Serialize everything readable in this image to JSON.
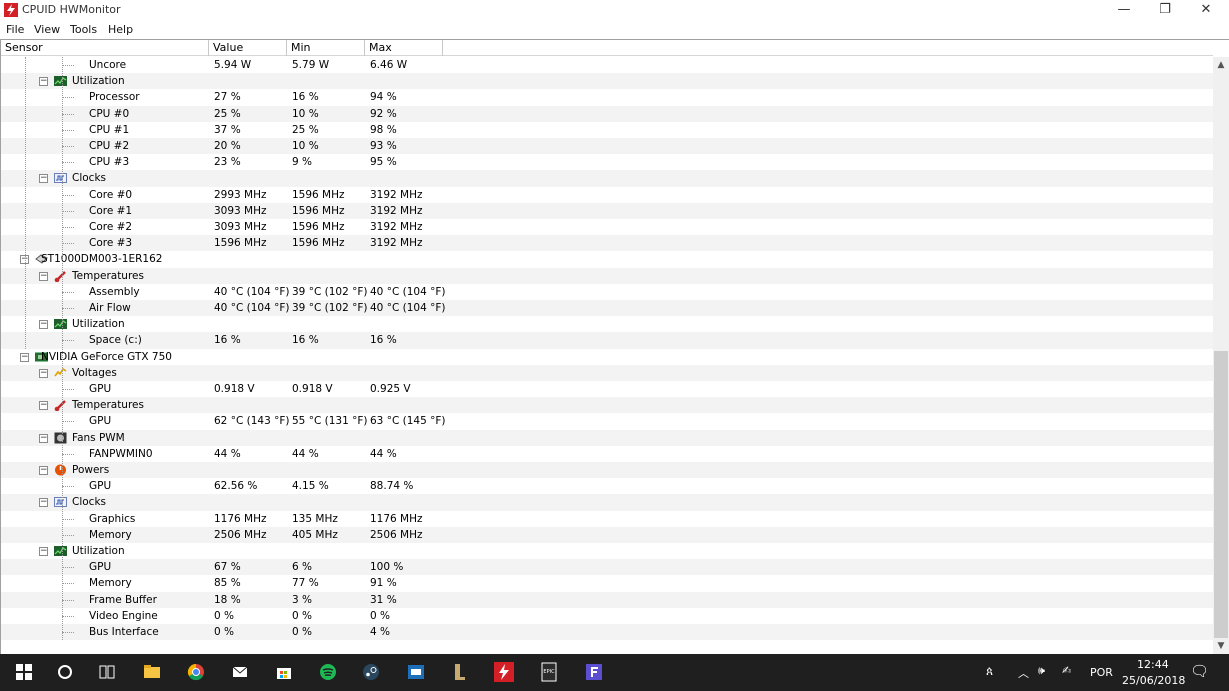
{
  "window": {
    "title": "CPUID HWMonitor",
    "min_glyph": "—",
    "max_glyph": "❐",
    "close_glyph": "✕"
  },
  "menu": [
    "File",
    "View",
    "Tools",
    "Help"
  ],
  "columns": {
    "sensor": "Sensor",
    "value": "Value",
    "min": "Min",
    "max": "Max"
  },
  "rows": [
    {
      "level": 2,
      "label": "Uncore",
      "value": "5.94 W",
      "min": "5.79 W",
      "max": "6.46 W"
    },
    {
      "level": 1,
      "label": "Utilization",
      "icon": "utilization-icon"
    },
    {
      "level": 2,
      "label": "Processor",
      "value": "27 %",
      "min": "16 %",
      "max": "94 %"
    },
    {
      "level": 2,
      "label": "CPU #0",
      "value": "25 %",
      "min": "10 %",
      "max": "92 %"
    },
    {
      "level": 2,
      "label": "CPU #1",
      "value": "37 %",
      "min": "25 %",
      "max": "98 %"
    },
    {
      "level": 2,
      "label": "CPU #2",
      "value": "20 %",
      "min": "10 %",
      "max": "93 %"
    },
    {
      "level": 2,
      "label": "CPU #3",
      "value": "23 %",
      "min": "9 %",
      "max": "95 %"
    },
    {
      "level": 1,
      "label": "Clocks",
      "icon": "clocks-icon"
    },
    {
      "level": 2,
      "label": "Core #0",
      "value": "2993 MHz",
      "min": "1596 MHz",
      "max": "3192 MHz"
    },
    {
      "level": 2,
      "label": "Core #1",
      "value": "3093 MHz",
      "min": "1596 MHz",
      "max": "3192 MHz"
    },
    {
      "level": 2,
      "label": "Core #2",
      "value": "3093 MHz",
      "min": "1596 MHz",
      "max": "3192 MHz"
    },
    {
      "level": 2,
      "label": "Core #3",
      "value": "1596 MHz",
      "min": "1596 MHz",
      "max": "3192 MHz"
    },
    {
      "level": 0,
      "label": "ST1000DM003-1ER162",
      "icon": "hard-drive-icon"
    },
    {
      "level": 1,
      "label": "Temperatures",
      "icon": "thermometer-icon"
    },
    {
      "level": 2,
      "label": "Assembly",
      "value": "40 °C  (104 °F)",
      "min": "39 °C  (102 °F)",
      "max": "40 °C  (104 °F)"
    },
    {
      "level": 2,
      "label": "Air Flow",
      "value": "40 °C  (104 °F)",
      "min": "39 °C  (102 °F)",
      "max": "40 °C  (104 °F)"
    },
    {
      "level": 1,
      "label": "Utilization",
      "icon": "utilization-icon"
    },
    {
      "level": 2,
      "label": "Space (c:)",
      "value": "16 %",
      "min": "16 %",
      "max": "16 %"
    },
    {
      "level": 0,
      "label": "NVIDIA GeForce GTX 750",
      "icon": "gpu-icon"
    },
    {
      "level": 1,
      "label": "Voltages",
      "icon": "voltage-icon"
    },
    {
      "level": 2,
      "label": "GPU",
      "value": "0.918 V",
      "min": "0.918 V",
      "max": "0.925 V"
    },
    {
      "level": 1,
      "label": "Temperatures",
      "icon": "thermometer-icon"
    },
    {
      "level": 2,
      "label": "GPU",
      "value": "62 °C  (143 °F)",
      "min": "55 °C  (131 °F)",
      "max": "63 °C  (145 °F)"
    },
    {
      "level": 1,
      "label": "Fans PWM",
      "icon": "fan-icon"
    },
    {
      "level": 2,
      "label": "FANPWMIN0",
      "value": "44 %",
      "min": "44 %",
      "max": "44 %"
    },
    {
      "level": 1,
      "label": "Powers",
      "icon": "power-icon"
    },
    {
      "level": 2,
      "label": "GPU",
      "value": "62.56 %",
      "min": "4.15 %",
      "max": "88.74 %"
    },
    {
      "level": 1,
      "label": "Clocks",
      "icon": "clocks-icon"
    },
    {
      "level": 2,
      "label": "Graphics",
      "value": "1176 MHz",
      "min": "135 MHz",
      "max": "1176 MHz"
    },
    {
      "level": 2,
      "label": "Memory",
      "value": "2506 MHz",
      "min": "405 MHz",
      "max": "2506 MHz"
    },
    {
      "level": 1,
      "label": "Utilization",
      "icon": "utilization-icon"
    },
    {
      "level": 2,
      "label": "GPU",
      "value": "67 %",
      "min": "6 %",
      "max": "100 %"
    },
    {
      "level": 2,
      "label": "Memory",
      "value": "85 %",
      "min": "77 %",
      "max": "91 %"
    },
    {
      "level": 2,
      "label": "Frame Buffer",
      "value": "18 %",
      "min": "3 %",
      "max": "31 %"
    },
    {
      "level": 2,
      "label": "Video Engine",
      "value": "0 %",
      "min": "0 %",
      "max": "0 %"
    },
    {
      "level": 2,
      "label": "Bus Interface",
      "value": "0 %",
      "min": "0 %",
      "max": "4 %"
    }
  ],
  "taskbar": {
    "apps": [
      "start-icon",
      "cortana-icon",
      "task-view-icon",
      "file-explorer-icon",
      "chrome-icon",
      "mail-icon",
      "store-icon",
      "spotify-icon",
      "steam-icon",
      "app-icon",
      "league-icon",
      "hwmonitor-icon",
      "epic-games-icon",
      "app-f-icon"
    ],
    "language": "POR",
    "time": "12:44",
    "date": "25/06/2018"
  },
  "colors": {
    "brand_red": "#d32027",
    "taskbar": "#1f1f1f",
    "row_alt": "#f3f3f3"
  }
}
